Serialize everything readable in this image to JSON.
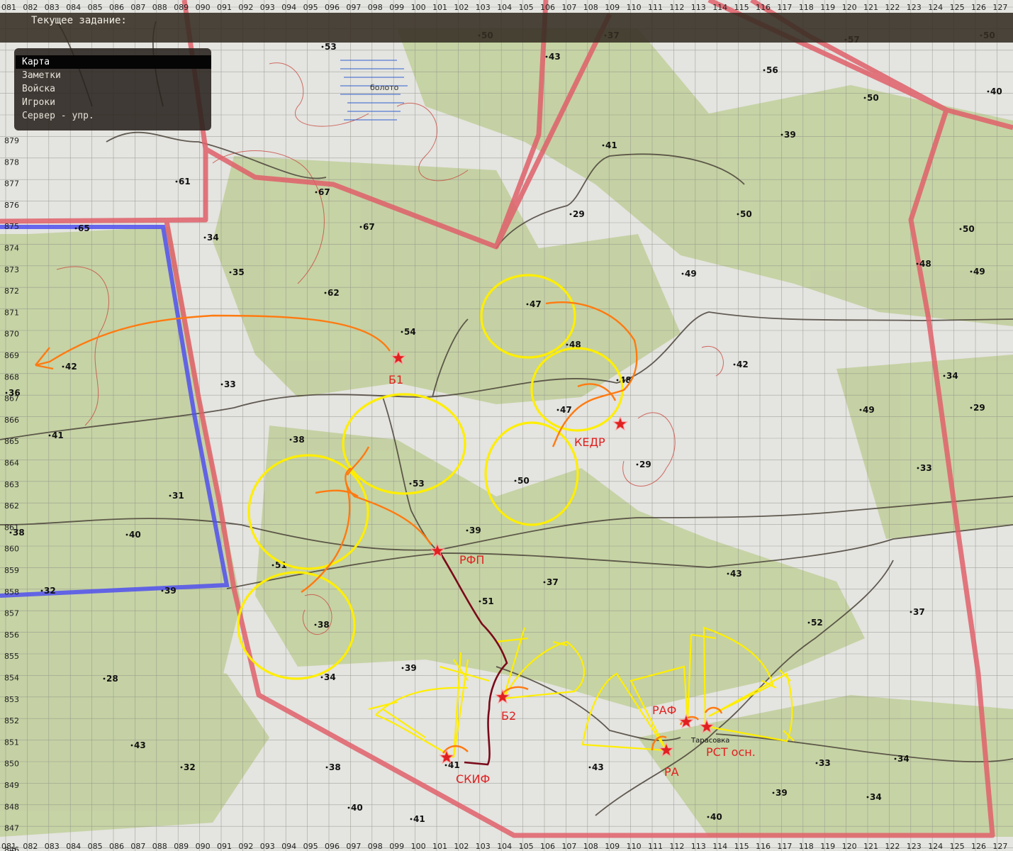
{
  "header": {
    "task_label": "Текущее задание:"
  },
  "menu": {
    "items": [
      "Карта",
      "Заметки",
      "Войска",
      "Игроки",
      "Сервер - упр."
    ],
    "active_index": 0
  },
  "grid": {
    "x_labels": [
      "081",
      "082",
      "083",
      "084",
      "085",
      "086",
      "087",
      "088",
      "089",
      "090",
      "091",
      "092",
      "093",
      "094",
      "095",
      "096",
      "097",
      "098",
      "099",
      "100",
      "101",
      "102",
      "103",
      "104",
      "105",
      "106",
      "107",
      "108",
      "109",
      "110",
      "111",
      "112",
      "113",
      "114",
      "115",
      "116",
      "117",
      "118",
      "119",
      "120",
      "121",
      "122",
      "123",
      "124",
      "125",
      "126",
      "127"
    ],
    "y_labels": [
      "879",
      "878",
      "877",
      "876",
      "875",
      "874",
      "873",
      "872",
      "871",
      "870",
      "869",
      "868",
      "867",
      "866",
      "865",
      "864",
      "863",
      "862",
      "861",
      "860",
      "859",
      "858",
      "857",
      "856",
      "855",
      "854",
      "853",
      "852",
      "851",
      "850",
      "849",
      "848",
      "847",
      "846"
    ]
  },
  "terrain_labels": {
    "swamp": "болото",
    "village": "Тарасовка"
  },
  "elevations": [
    "53",
    "50",
    "37",
    "43",
    "56",
    "50",
    "40",
    "39",
    "41",
    "61",
    "67",
    "67",
    "65",
    "34",
    "35",
    "62",
    "54",
    "48",
    "47",
    "48",
    "49",
    "42",
    "42",
    "33",
    "38",
    "36",
    "47",
    "49",
    "41",
    "34",
    "29",
    "29",
    "53",
    "50",
    "33",
    "31",
    "39",
    "40",
    "38",
    "51",
    "43",
    "37",
    "39",
    "32",
    "51",
    "38",
    "52",
    "37",
    "28",
    "39",
    "34",
    "43",
    "32",
    "38",
    "41",
    "43",
    "33",
    "34",
    "40",
    "41",
    "39",
    "34",
    "40",
    "29",
    "50",
    "48",
    "49",
    "50",
    "57",
    "50"
  ],
  "markers": [
    {
      "label": "Б1"
    },
    {
      "label": "КЕДР"
    },
    {
      "label": "РФП"
    },
    {
      "label": "Б2"
    },
    {
      "label": "СКИФ"
    },
    {
      "label": "РАФ"
    },
    {
      "label": "РА"
    },
    {
      "label": "РСТ осн."
    }
  ],
  "colors": {
    "map_background": "#e4e4e0",
    "forest": "#c2d09e",
    "grid": "#8a8a84",
    "road": "#4a4238",
    "main_road": "#e0606a",
    "border": "#5050ee",
    "marker": "#e02020",
    "drawing_yellow": "#ffee00",
    "drawing_orange": "#ff7a10",
    "route_dark": "#7a0a1a",
    "menu_bg": "#2a221a"
  }
}
